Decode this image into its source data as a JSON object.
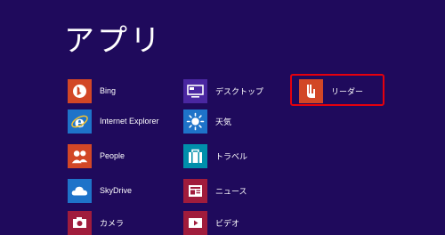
{
  "screen": {
    "title": "アプリ",
    "background_color": "#1f0a5c",
    "highlight_color": "#e5000d"
  },
  "apps": {
    "column_1": [
      {
        "label": "Bing",
        "icon": "bing-icon",
        "tile_color": "#d24726"
      },
      {
        "label": "Internet Explorer",
        "icon": "internet-explorer-icon",
        "tile_color": "#1e73c9"
      },
      {
        "label": "People",
        "icon": "people-icon",
        "tile_color": "#d24726"
      },
      {
        "label": "SkyDrive",
        "icon": "skydrive-icon",
        "tile_color": "#1e73c9"
      },
      {
        "label": "カメラ",
        "icon": "camera-icon",
        "tile_color": "#a01c3c"
      }
    ],
    "column_2": [
      {
        "label": "デスクトップ",
        "icon": "desktop-icon",
        "tile_color": "#4a27a1"
      },
      {
        "label": "天気",
        "icon": "weather-icon",
        "tile_color": "#1e73c9"
      },
      {
        "label": "トラベル",
        "icon": "travel-icon",
        "tile_color": "#008fab"
      },
      {
        "label": "ニュース",
        "icon": "news-icon",
        "tile_color": "#a01c3c"
      },
      {
        "label": "ビデオ",
        "icon": "video-icon",
        "tile_color": "#a01c3c"
      }
    ],
    "column_3": [
      {
        "label": "リーダー",
        "icon": "reader-icon",
        "tile_color": "#d24726",
        "highlighted": true
      }
    ]
  }
}
